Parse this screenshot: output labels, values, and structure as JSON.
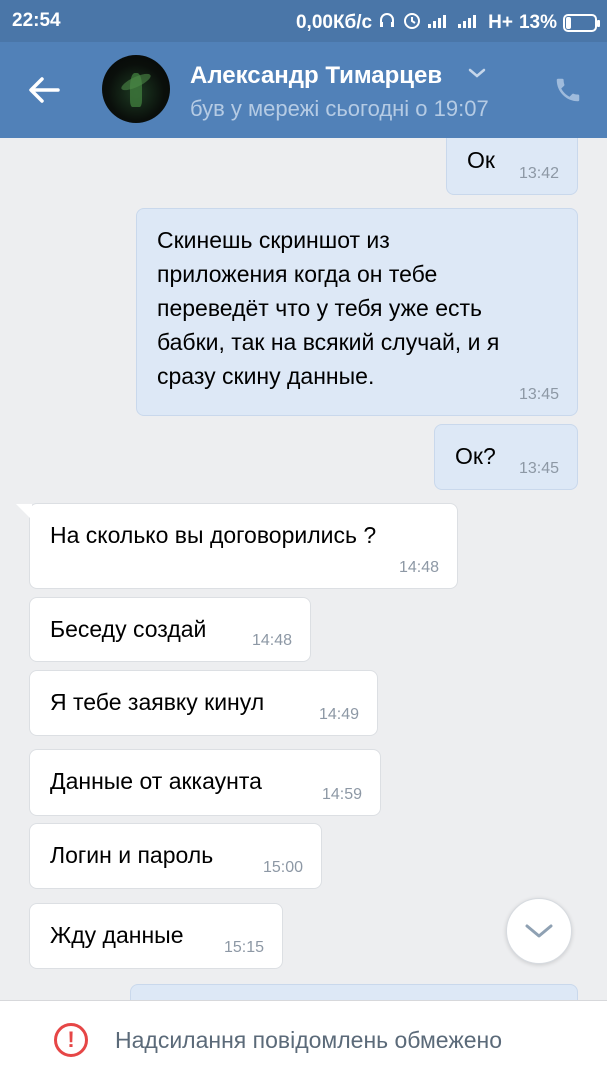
{
  "status_bar": {
    "time": "22:54",
    "network_speed": "0,00Кб/с",
    "network_type": "H+",
    "battery": "13%"
  },
  "header": {
    "contact_name": "Александр Тимарцев",
    "contact_status": "був у мережі сьогодні о 19:07"
  },
  "messages": [
    {
      "direction": "out",
      "text": "Ок",
      "time": "13:42"
    },
    {
      "direction": "out",
      "lines": [
        "Скинешь скриншот из",
        "приложения когда он тебе",
        "переведёт что у тебя уже есть",
        "бабки, так на всякий случай, и я",
        "сразу скину данные."
      ],
      "time": "13:45"
    },
    {
      "direction": "out",
      "text": "Ок?",
      "time": "13:45"
    },
    {
      "direction": "in",
      "text": "На сколько вы договорились ?",
      "time": "14:48"
    },
    {
      "direction": "in",
      "text": "Беседу создай",
      "time": "14:48"
    },
    {
      "direction": "in",
      "text": "Я тебе заявку кинул",
      "time": "14:49"
    },
    {
      "direction": "in",
      "text": "Данные от аккаунта",
      "time": "14:59"
    },
    {
      "direction": "in",
      "text": "Логин и пароль",
      "time": "15:00"
    },
    {
      "direction": "in",
      "text": "Жду данные",
      "time": "15:15"
    }
  ],
  "footer": {
    "restriction_text": "Надсилання повідомлень обмежено"
  },
  "colors": {
    "status_bar": "#4a76a8",
    "header": "#5181b8",
    "chat_bg": "#edeef0",
    "outgoing_bubble": "#dde8f6",
    "incoming_bubble": "#ffffff",
    "warning": "#e64646"
  },
  "icons": [
    "back-arrow-icon",
    "chevron-down-icon",
    "phone-icon",
    "scroll-down-chevron-icon",
    "warning-circle-icon",
    "headphones-icon",
    "alarm-icon",
    "signal-icon",
    "battery-icon"
  ]
}
